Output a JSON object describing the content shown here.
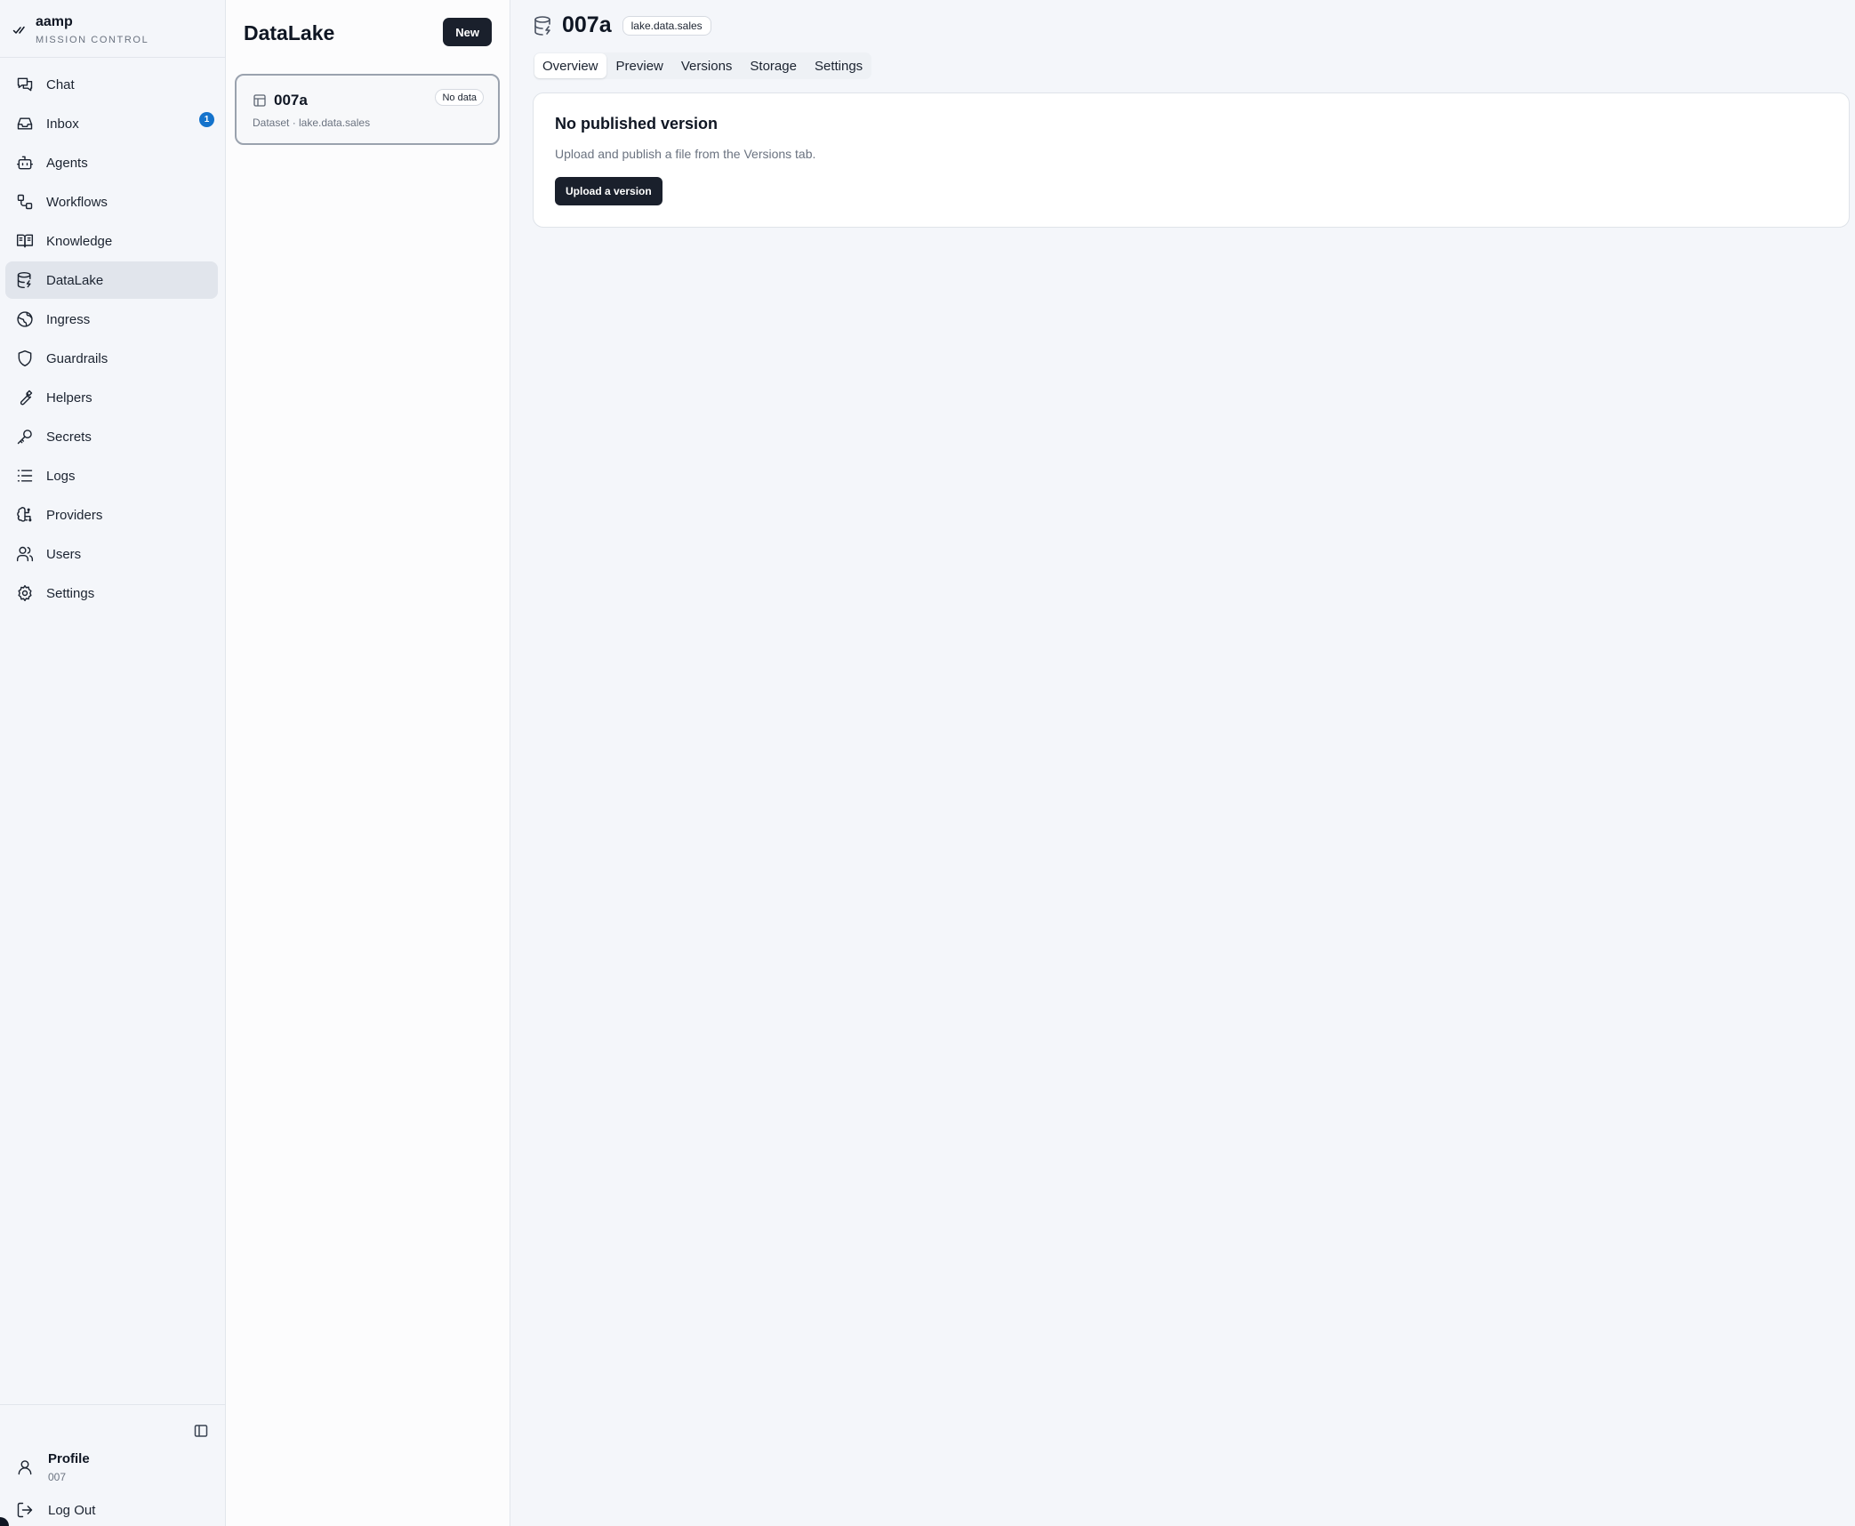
{
  "brand": {
    "name": "aamp",
    "subtitle": "MISSION CONTROL"
  },
  "sidebar": {
    "items": [
      {
        "label": "Chat",
        "icon": "chat-icon"
      },
      {
        "label": "Inbox",
        "icon": "inbox-icon",
        "badge": "1"
      },
      {
        "label": "Agents",
        "icon": "bot-icon"
      },
      {
        "label": "Workflows",
        "icon": "workflow-icon"
      },
      {
        "label": "Knowledge",
        "icon": "book-icon"
      },
      {
        "label": "DataLake",
        "icon": "database-icon",
        "active": true
      },
      {
        "label": "Ingress",
        "icon": "globe-icon"
      },
      {
        "label": "Guardrails",
        "icon": "shield-icon"
      },
      {
        "label": "Helpers",
        "icon": "wrench-icon"
      },
      {
        "label": "Secrets",
        "icon": "key-icon"
      },
      {
        "label": "Logs",
        "icon": "list-icon"
      },
      {
        "label": "Providers",
        "icon": "brain-icon"
      },
      {
        "label": "Users",
        "icon": "users-icon"
      },
      {
        "label": "Settings",
        "icon": "gear-icon"
      }
    ],
    "profile": {
      "name": "Profile",
      "sub": "007"
    },
    "logout_label": "Log Out"
  },
  "list": {
    "title": "DataLake",
    "new_label": "New",
    "card": {
      "title": "007a",
      "badge": "No data",
      "subtitle": "Dataset · lake.data.sales"
    }
  },
  "detail": {
    "title": "007a",
    "tag": "lake.data.sales",
    "tabs": [
      "Overview",
      "Preview",
      "Versions",
      "Storage",
      "Settings"
    ],
    "active_tab": "Overview",
    "panel": {
      "title": "No published version",
      "description": "Upload and publish a file from the Versions tab.",
      "button_label": "Upload a version"
    }
  },
  "colors": {
    "accent_dark": "#1a202c",
    "badge_blue": "#1473cc",
    "active_nav": "#e1e5ec"
  }
}
